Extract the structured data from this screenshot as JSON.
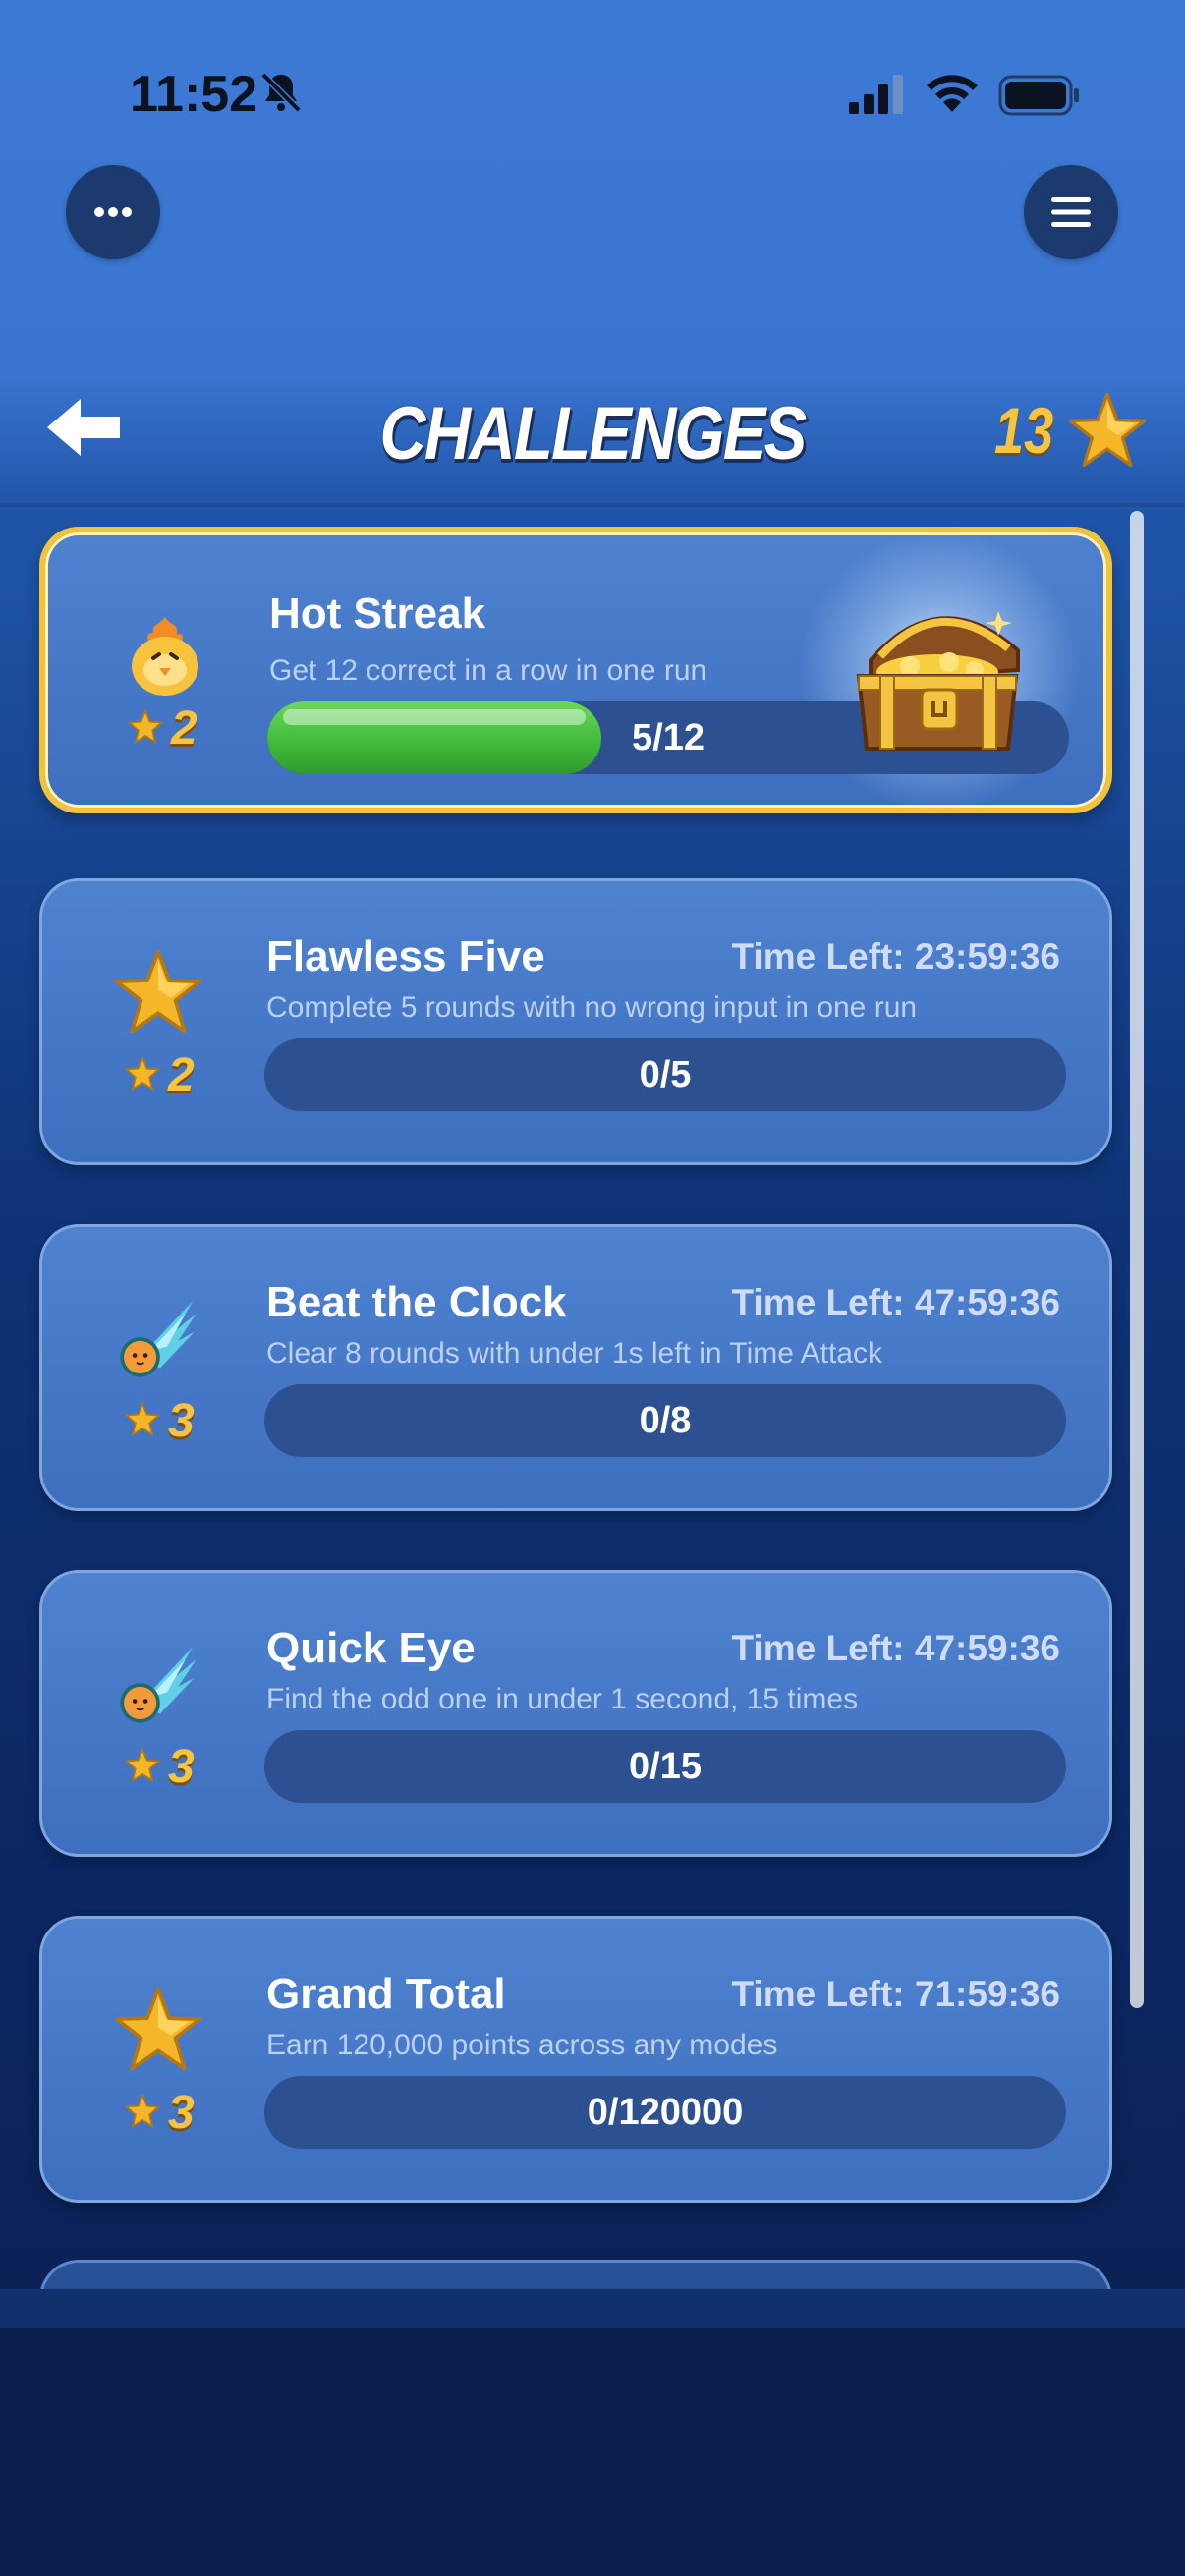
{
  "status_bar": {
    "time": "11:52",
    "icons": [
      "bell-slash-icon",
      "cellular-signal-icon",
      "wifi-icon",
      "battery-icon"
    ]
  },
  "top_controls": {
    "more_icon": "more-horizontal-icon",
    "menu_icon": "hamburger-menu-icon"
  },
  "header": {
    "back_icon": "arrow-left-icon",
    "title": "CHALLENGES",
    "star_total": "13",
    "star_icon": "star-icon"
  },
  "colors": {
    "accent_gold": "#f5c443",
    "progress_green": "#3fb83a",
    "card_blue": "#4e82cf",
    "highlight_border": "#f2c23b"
  },
  "challenges": [
    {
      "title": "Hot Streak",
      "description": "Get 12 correct in a row in one run",
      "time_left": "",
      "reward": "2",
      "progress_text": "5/12",
      "progress": 0.4167,
      "icon": "flame-chick-icon",
      "highlighted": true,
      "bonus_icon": "treasure-chest-icon"
    },
    {
      "title": "Flawless Five",
      "description": "Complete 5 rounds with no wrong input in one run",
      "time_left": "Time Left: 23:59:36",
      "reward": "2",
      "progress_text": "0/5",
      "progress": 0,
      "icon": "star-icon"
    },
    {
      "title": "Beat the Clock",
      "description": "Clear 8 rounds with under 1s left in Time Attack",
      "time_left": "Time Left: 47:59:36",
      "reward": "3",
      "progress_text": "0/8",
      "progress": 0,
      "icon": "comet-icon"
    },
    {
      "title": "Quick Eye",
      "description": "Find the odd one in under 1 second, 15 times",
      "time_left": "Time Left: 47:59:36",
      "reward": "3",
      "progress_text": "0/15",
      "progress": 0,
      "icon": "comet-icon"
    },
    {
      "title": "Grand Total",
      "description": "Earn 120,000 points across any modes",
      "time_left": "Time Left: 71:59:36",
      "reward": "3",
      "progress_text": "0/120000",
      "progress": 0,
      "icon": "star-icon"
    }
  ]
}
